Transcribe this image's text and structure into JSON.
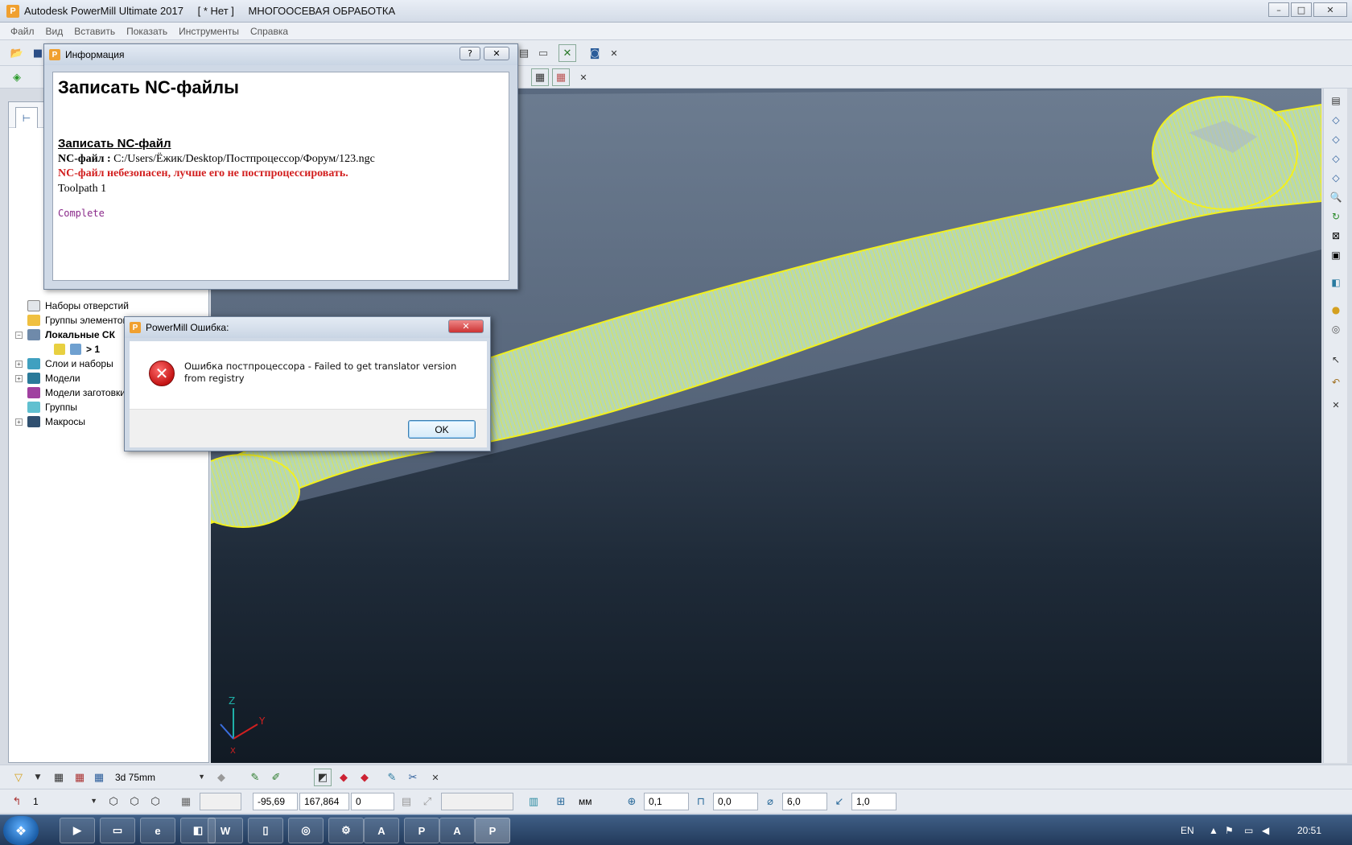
{
  "window": {
    "title_app": "Autodesk PowerMill Ultimate 2017",
    "title_project": "[ * Нет ]",
    "title_mode": "МНОГООСЕВАЯ ОБРАБОТКА",
    "minimize": "–",
    "maximize": "□",
    "close": "✕"
  },
  "menu": [
    "Файл",
    "Вид",
    "Вставить",
    "Показать",
    "Инструменты",
    "Справка"
  ],
  "explorer": {
    "items": [
      {
        "label": "Наборы отверстий",
        "bold": false
      },
      {
        "label": "Группы элементов",
        "bold": false
      },
      {
        "label": "Локальные СК",
        "bold": true
      },
      {
        "label": "> 1",
        "bold": true
      },
      {
        "label": "Слои и наборы",
        "bold": false
      },
      {
        "label": "Модели",
        "bold": false
      },
      {
        "label": "Модели заготовки",
        "bold": false
      },
      {
        "label": "Группы",
        "bold": false
      },
      {
        "label": "Макросы",
        "bold": false
      }
    ]
  },
  "info_dialog": {
    "title": "Информация",
    "help": "?",
    "close": "✕",
    "heading": "Записать NC-файлы",
    "subheading": "Записать NC-файл",
    "nc_file_label": "NC-файл :",
    "nc_file_path": "C:/Users/Ёжик/Desktop/Постпроцессор/Форум/123.ngc",
    "warning": "NC-файл небезопасен, лучше его не постпроцессировать.",
    "toolpath": "Toolpath 1",
    "status": "Complete"
  },
  "error_dialog": {
    "title": "PowerMill Ошибка:",
    "close": "✕",
    "message": "Ошибка постпроцессора - Failed to get translator version from registry",
    "ok": "OK"
  },
  "bottom_bar_1": {
    "tool_combo": "3d 75mm"
  },
  "bottom_bar_2": {
    "workplane_combo": "1",
    "coord_x": "-95,69",
    "coord_y": "167,864",
    "coord_z": "0",
    "units": "мм",
    "tolerance": "0,1",
    "thickness": "0,0",
    "diameter": "6,0",
    "stepover": "1,0"
  },
  "taskbar": {
    "lang": "EN",
    "time": "20:51"
  },
  "axes": {
    "z": "Z",
    "y": "Y",
    "x": "X"
  },
  "colors": {
    "toolpath": "#f2f01e",
    "part": "#b8d8b0",
    "error": "#d21f1f"
  }
}
